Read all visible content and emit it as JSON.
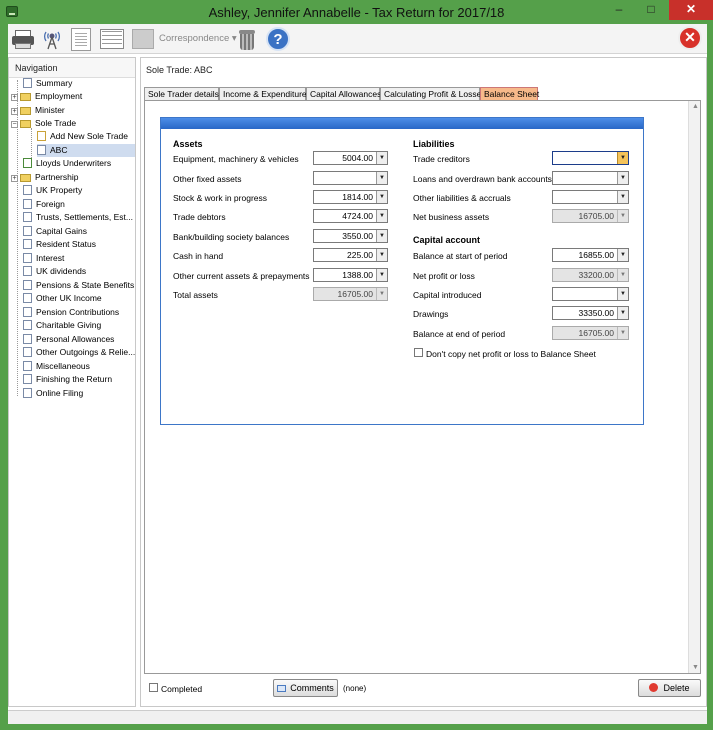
{
  "window": {
    "title": "Ashley, Jennifer Annabelle - Tax Return for 2017/18",
    "min": "–",
    "max": "□",
    "close": "✕"
  },
  "toolbar": {
    "correspondence": "Correspondence ▾",
    "help": "?",
    "exit": "✕"
  },
  "nav": {
    "header": "Navigation",
    "items": [
      "Summary",
      "Employment",
      "Minister",
      "Sole Trade",
      "Add New Sole Trade",
      "ABC",
      "Lloyds Underwriters",
      "Partnership",
      "UK Property",
      "Foreign",
      "Trusts, Settlements, Est...",
      "Capital Gains",
      "Resident Status",
      "Interest",
      "UK dividends",
      "Pensions & State Benefits",
      "Other UK Income",
      "Pension Contributions",
      "Charitable Giving",
      "Personal Allowances",
      "Other Outgoings & Relie...",
      "Miscellaneous",
      "Finishing the Return",
      "Online Filing"
    ]
  },
  "main": {
    "breadcrumb": "Sole Trade: ABC",
    "tabs": [
      "Sole Trader details",
      "Income & Expenditure",
      "Capital Allowances",
      "Calculating Profit & Losses",
      "Balance Sheet"
    ],
    "assets": {
      "heading": "Assets",
      "rows": [
        {
          "label": "Equipment, machinery & vehicles",
          "value": "5004.00"
        },
        {
          "label": "Other fixed assets",
          "value": ""
        },
        {
          "label": "Stock & work in progress",
          "value": "1814.00"
        },
        {
          "label": "Trade debtors",
          "value": "4724.00"
        },
        {
          "label": "Bank/building society balances",
          "value": "3550.00"
        },
        {
          "label": "Cash in hand",
          "value": "225.00"
        },
        {
          "label": "Other current assets & prepayments",
          "value": "1388.00"
        },
        {
          "label": "Total assets",
          "value": "16705.00"
        }
      ]
    },
    "liabilities": {
      "heading": "Liabilities",
      "rows": [
        {
          "label": "Trade creditors",
          "value": ""
        },
        {
          "label": "Loans and overdrawn bank accounts",
          "value": ""
        },
        {
          "label": "Other liabilities & accruals",
          "value": ""
        },
        {
          "label": "Net business assets",
          "value": "16705.00"
        }
      ]
    },
    "capital": {
      "heading": "Capital account",
      "rows": [
        {
          "label": "Balance at start of period",
          "value": "16855.00"
        },
        {
          "label": "Net profit or loss",
          "value": "33200.00"
        },
        {
          "label": "Capital introduced",
          "value": ""
        },
        {
          "label": "Drawings",
          "value": "33350.00"
        },
        {
          "label": "Balance at end of period",
          "value": "16705.00"
        }
      ],
      "dont_copy": "Don't copy net profit or loss to Balance Sheet"
    }
  },
  "footer": {
    "completed": "Completed",
    "comments": "Comments",
    "comments_status": "(none)",
    "delete": "Delete"
  }
}
